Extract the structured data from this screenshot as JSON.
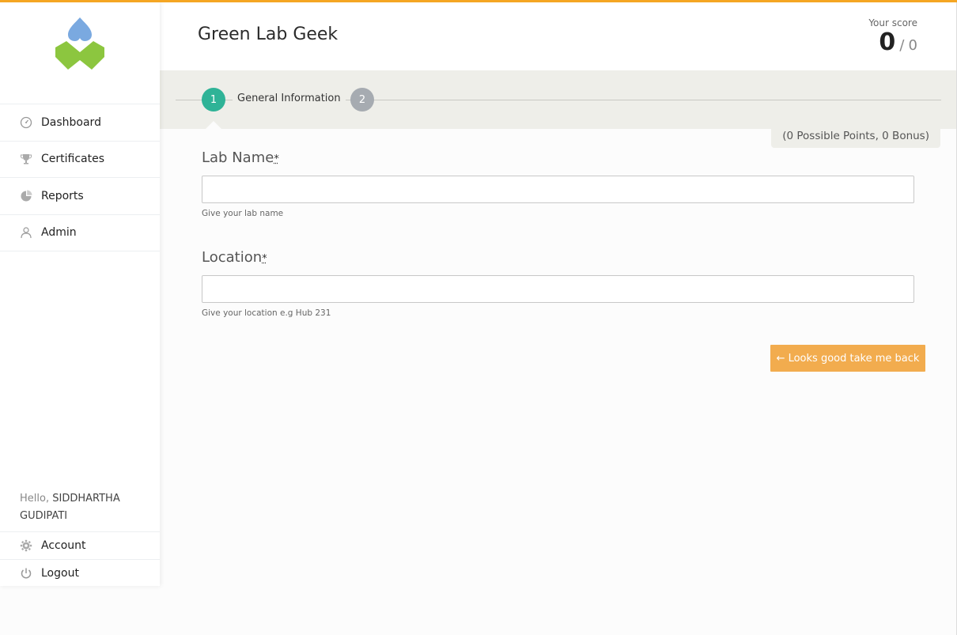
{
  "colors": {
    "accent": "#f5a623",
    "step_active": "#2fb397",
    "step_inactive": "#a6abb1",
    "button": "#f2ac4e",
    "logo_blue": "#7aa9e0",
    "logo_green": "#8cc63f"
  },
  "sidebar": {
    "logo_icon": "leaf-drop-logo",
    "items": [
      {
        "label": "Dashboard",
        "icon": "dashboard-icon"
      },
      {
        "label": "Certificates",
        "icon": "trophy-icon"
      },
      {
        "label": "Reports",
        "icon": "pie-chart-icon"
      },
      {
        "label": "Admin",
        "icon": "users-icon"
      }
    ],
    "greeting": "Hello,",
    "user_name": "SIDDHARTHA GUDIPATI",
    "account_label": "Account",
    "logout_label": "Logout"
  },
  "header": {
    "title": "Green Lab Geek",
    "score_label": "Your score",
    "score_value": "0",
    "score_sep": "/",
    "score_max": "0"
  },
  "steps": [
    {
      "number": "1",
      "label": "General Information",
      "active": true
    },
    {
      "number": "2",
      "label": "",
      "active": false
    }
  ],
  "points_info": "(0 Possible Points, 0 Bonus)",
  "form": {
    "required_mark": "*",
    "lab_name": {
      "label": "Lab Name",
      "value": "",
      "help": "Give your lab name"
    },
    "location": {
      "label": "Location",
      "value": "",
      "help": "Give your location e.g Hub 231"
    }
  },
  "back_button_label": "← Looks good take me back"
}
